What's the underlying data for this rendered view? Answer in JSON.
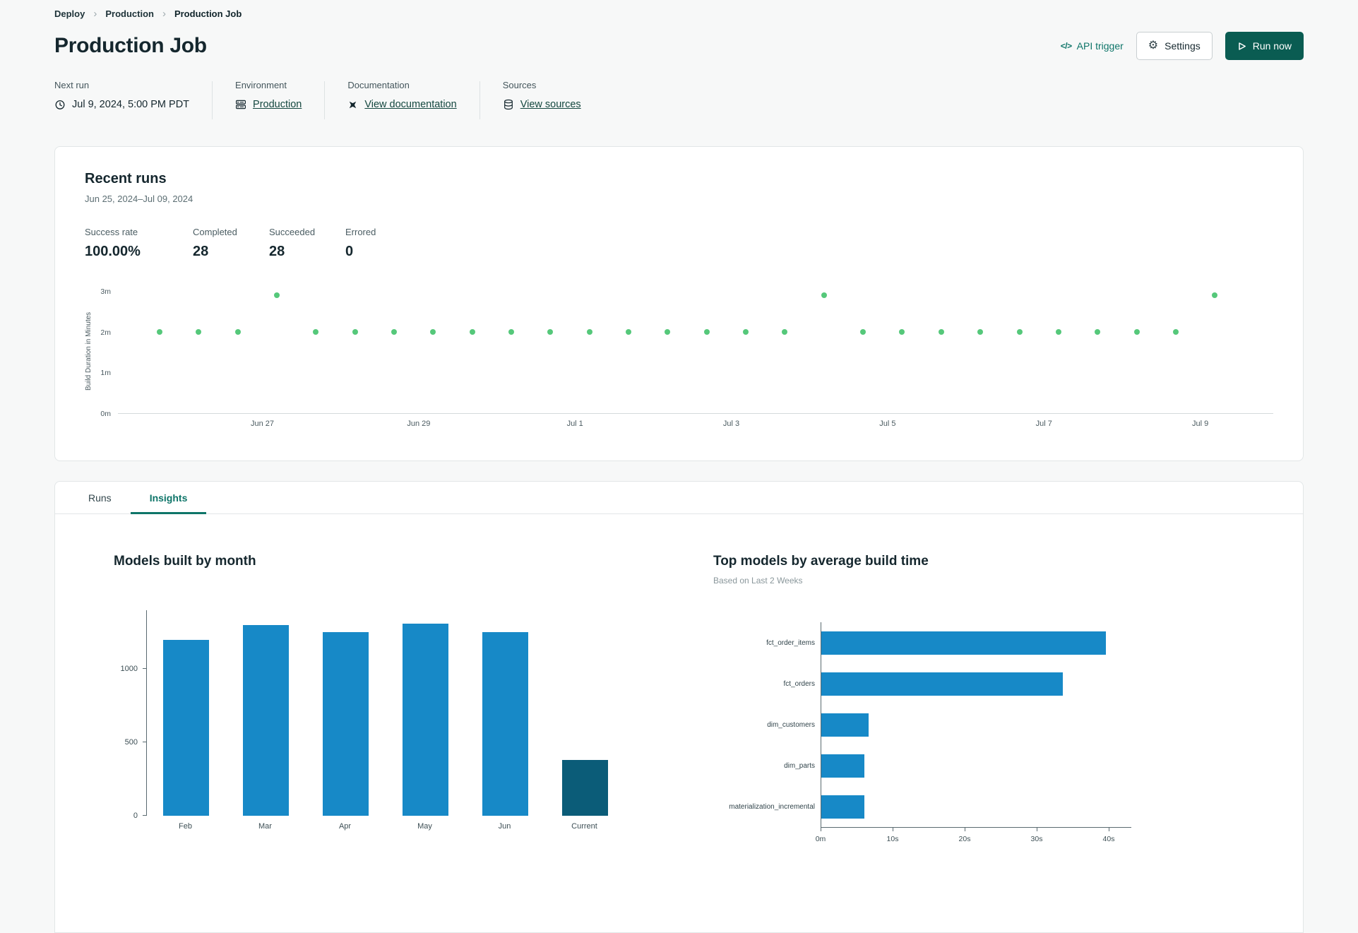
{
  "colors": {
    "accent_teal": "#0e7569",
    "run_now_bg": "#0a5c52",
    "dot_green": "#55c87a",
    "bar_blue": "#1789c7",
    "bar_dark": "#0b5c78",
    "link_dark": "#14473f"
  },
  "breadcrumb": {
    "items": [
      {
        "label": "Deploy"
      },
      {
        "label": "Production"
      },
      {
        "label": "Production Job"
      }
    ]
  },
  "header": {
    "title": "Production Job",
    "api_trigger_label": "API trigger",
    "settings_label": "Settings",
    "run_now_label": "Run now"
  },
  "meta": [
    {
      "label": "Next run",
      "value": "Jul 9, 2024, 5:00 PM PDT"
    },
    {
      "label": "Environment",
      "value": "Production"
    },
    {
      "label": "Documentation",
      "value": "View documentation"
    },
    {
      "label": "Sources",
      "value": "View sources"
    }
  ],
  "recent_runs": {
    "title": "Recent runs",
    "date_range": "Jun 25, 2024–Jul 09, 2024",
    "stats": [
      {
        "label": "Success rate",
        "value": "100.00%"
      },
      {
        "label": "Completed",
        "value": "28"
      },
      {
        "label": "Succeeded",
        "value": "28"
      },
      {
        "label": "Errored",
        "value": "0"
      }
    ]
  },
  "tabs": [
    {
      "label": "Runs",
      "active": false
    },
    {
      "label": "Insights",
      "active": true
    }
  ],
  "chart_data": [
    {
      "type": "scatter",
      "title": "Recent runs",
      "ylabel": "Build Duration in Minutes",
      "y_ticks": [
        "0m",
        "1m",
        "2m",
        "3m"
      ],
      "x_ticks": [
        "Jun 27",
        "Jun 29",
        "Jul 1",
        "Jul 3",
        "Jul 5",
        "Jul 7",
        "Jul 9"
      ],
      "ylim": [
        0,
        3
      ],
      "point_color": "#55c87a",
      "values_minutes": [
        2,
        2,
        2,
        2.9,
        2,
        2,
        2,
        2,
        2,
        2,
        2,
        2,
        2,
        2,
        2,
        2,
        2,
        2.9,
        2,
        2,
        2,
        2,
        2,
        2,
        2,
        2,
        2,
        2.9
      ]
    },
    {
      "type": "bar",
      "title": "Models built by month",
      "categories": [
        "Feb",
        "Mar",
        "Apr",
        "May",
        "Jun",
        "Current"
      ],
      "values": [
        1200,
        1300,
        1250,
        1310,
        1250,
        380
      ],
      "y_ticks": [
        0,
        500,
        1000
      ],
      "ylim": [
        0,
        1400
      ],
      "bar_colors": [
        "#1789c7",
        "#1789c7",
        "#1789c7",
        "#1789c7",
        "#1789c7",
        "#0b5c78"
      ]
    },
    {
      "type": "bar",
      "orientation": "horizontal",
      "title": "Top models by average build time",
      "subtitle": "Based on Last 2 Weeks",
      "categories": [
        "fct_order_items",
        "fct_orders",
        "dim_customers",
        "dim_parts",
        "materialization_incremental"
      ],
      "values_seconds": [
        39.5,
        33.5,
        6.6,
        6.0,
        6.0
      ],
      "x_ticks": [
        "0m",
        "10s",
        "20s",
        "30s",
        "40s"
      ],
      "xlim_seconds": [
        0,
        43
      ],
      "bar_color": "#1789c7"
    }
  ]
}
